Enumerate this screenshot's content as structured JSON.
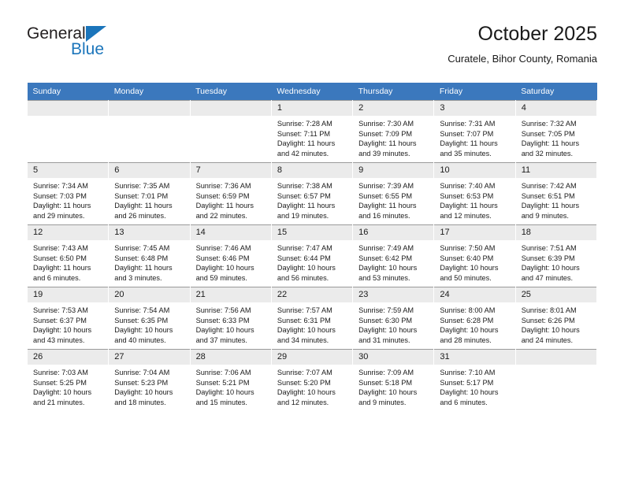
{
  "brand": {
    "name_top": "General",
    "name_bottom": "Blue",
    "accent_color": "#1b75bb"
  },
  "header": {
    "title": "October 2025",
    "subtitle": "Curatele, Bihor County, Romania"
  },
  "theme": {
    "header_row_bg": "#3b78bd",
    "daynum_bg": "#ebebeb",
    "text_color": "#1a1a1a"
  },
  "weekday_headers": [
    "Sunday",
    "Monday",
    "Tuesday",
    "Wednesday",
    "Thursday",
    "Friday",
    "Saturday"
  ],
  "weeks": [
    [
      {
        "day": "",
        "lines": []
      },
      {
        "day": "",
        "lines": []
      },
      {
        "day": "",
        "lines": []
      },
      {
        "day": "1",
        "lines": [
          "Sunrise: 7:28 AM",
          "Sunset: 7:11 PM",
          "Daylight: 11 hours",
          "and 42 minutes."
        ]
      },
      {
        "day": "2",
        "lines": [
          "Sunrise: 7:30 AM",
          "Sunset: 7:09 PM",
          "Daylight: 11 hours",
          "and 39 minutes."
        ]
      },
      {
        "day": "3",
        "lines": [
          "Sunrise: 7:31 AM",
          "Sunset: 7:07 PM",
          "Daylight: 11 hours",
          "and 35 minutes."
        ]
      },
      {
        "day": "4",
        "lines": [
          "Sunrise: 7:32 AM",
          "Sunset: 7:05 PM",
          "Daylight: 11 hours",
          "and 32 minutes."
        ]
      }
    ],
    [
      {
        "day": "5",
        "lines": [
          "Sunrise: 7:34 AM",
          "Sunset: 7:03 PM",
          "Daylight: 11 hours",
          "and 29 minutes."
        ]
      },
      {
        "day": "6",
        "lines": [
          "Sunrise: 7:35 AM",
          "Sunset: 7:01 PM",
          "Daylight: 11 hours",
          "and 26 minutes."
        ]
      },
      {
        "day": "7",
        "lines": [
          "Sunrise: 7:36 AM",
          "Sunset: 6:59 PM",
          "Daylight: 11 hours",
          "and 22 minutes."
        ]
      },
      {
        "day": "8",
        "lines": [
          "Sunrise: 7:38 AM",
          "Sunset: 6:57 PM",
          "Daylight: 11 hours",
          "and 19 minutes."
        ]
      },
      {
        "day": "9",
        "lines": [
          "Sunrise: 7:39 AM",
          "Sunset: 6:55 PM",
          "Daylight: 11 hours",
          "and 16 minutes."
        ]
      },
      {
        "day": "10",
        "lines": [
          "Sunrise: 7:40 AM",
          "Sunset: 6:53 PM",
          "Daylight: 11 hours",
          "and 12 minutes."
        ]
      },
      {
        "day": "11",
        "lines": [
          "Sunrise: 7:42 AM",
          "Sunset: 6:51 PM",
          "Daylight: 11 hours",
          "and 9 minutes."
        ]
      }
    ],
    [
      {
        "day": "12",
        "lines": [
          "Sunrise: 7:43 AM",
          "Sunset: 6:50 PM",
          "Daylight: 11 hours",
          "and 6 minutes."
        ]
      },
      {
        "day": "13",
        "lines": [
          "Sunrise: 7:45 AM",
          "Sunset: 6:48 PM",
          "Daylight: 11 hours",
          "and 3 minutes."
        ]
      },
      {
        "day": "14",
        "lines": [
          "Sunrise: 7:46 AM",
          "Sunset: 6:46 PM",
          "Daylight: 10 hours",
          "and 59 minutes."
        ]
      },
      {
        "day": "15",
        "lines": [
          "Sunrise: 7:47 AM",
          "Sunset: 6:44 PM",
          "Daylight: 10 hours",
          "and 56 minutes."
        ]
      },
      {
        "day": "16",
        "lines": [
          "Sunrise: 7:49 AM",
          "Sunset: 6:42 PM",
          "Daylight: 10 hours",
          "and 53 minutes."
        ]
      },
      {
        "day": "17",
        "lines": [
          "Sunrise: 7:50 AM",
          "Sunset: 6:40 PM",
          "Daylight: 10 hours",
          "and 50 minutes."
        ]
      },
      {
        "day": "18",
        "lines": [
          "Sunrise: 7:51 AM",
          "Sunset: 6:39 PM",
          "Daylight: 10 hours",
          "and 47 minutes."
        ]
      }
    ],
    [
      {
        "day": "19",
        "lines": [
          "Sunrise: 7:53 AM",
          "Sunset: 6:37 PM",
          "Daylight: 10 hours",
          "and 43 minutes."
        ]
      },
      {
        "day": "20",
        "lines": [
          "Sunrise: 7:54 AM",
          "Sunset: 6:35 PM",
          "Daylight: 10 hours",
          "and 40 minutes."
        ]
      },
      {
        "day": "21",
        "lines": [
          "Sunrise: 7:56 AM",
          "Sunset: 6:33 PM",
          "Daylight: 10 hours",
          "and 37 minutes."
        ]
      },
      {
        "day": "22",
        "lines": [
          "Sunrise: 7:57 AM",
          "Sunset: 6:31 PM",
          "Daylight: 10 hours",
          "and 34 minutes."
        ]
      },
      {
        "day": "23",
        "lines": [
          "Sunrise: 7:59 AM",
          "Sunset: 6:30 PM",
          "Daylight: 10 hours",
          "and 31 minutes."
        ]
      },
      {
        "day": "24",
        "lines": [
          "Sunrise: 8:00 AM",
          "Sunset: 6:28 PM",
          "Daylight: 10 hours",
          "and 28 minutes."
        ]
      },
      {
        "day": "25",
        "lines": [
          "Sunrise: 8:01 AM",
          "Sunset: 6:26 PM",
          "Daylight: 10 hours",
          "and 24 minutes."
        ]
      }
    ],
    [
      {
        "day": "26",
        "lines": [
          "Sunrise: 7:03 AM",
          "Sunset: 5:25 PM",
          "Daylight: 10 hours",
          "and 21 minutes."
        ]
      },
      {
        "day": "27",
        "lines": [
          "Sunrise: 7:04 AM",
          "Sunset: 5:23 PM",
          "Daylight: 10 hours",
          "and 18 minutes."
        ]
      },
      {
        "day": "28",
        "lines": [
          "Sunrise: 7:06 AM",
          "Sunset: 5:21 PM",
          "Daylight: 10 hours",
          "and 15 minutes."
        ]
      },
      {
        "day": "29",
        "lines": [
          "Sunrise: 7:07 AM",
          "Sunset: 5:20 PM",
          "Daylight: 10 hours",
          "and 12 minutes."
        ]
      },
      {
        "day": "30",
        "lines": [
          "Sunrise: 7:09 AM",
          "Sunset: 5:18 PM",
          "Daylight: 10 hours",
          "and 9 minutes."
        ]
      },
      {
        "day": "31",
        "lines": [
          "Sunrise: 7:10 AM",
          "Sunset: 5:17 PM",
          "Daylight: 10 hours",
          "and 6 minutes."
        ]
      },
      {
        "day": "",
        "lines": []
      }
    ]
  ]
}
